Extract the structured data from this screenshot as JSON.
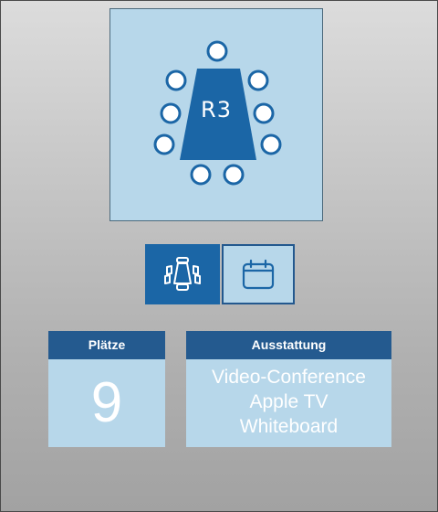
{
  "room": {
    "label": "R3",
    "table_color": "#1b66a6",
    "card_color": "#b7d7ea"
  },
  "tabs": {
    "seating": {
      "icon": "conference-table-icon",
      "selected": true
    },
    "calendar": {
      "icon": "calendar-icon",
      "selected": false
    }
  },
  "seats": {
    "header": "Plätze",
    "value": "9"
  },
  "equipment": {
    "header": "Ausstattung",
    "items": [
      "Video-Conference",
      "Apple TV",
      "Whiteboard"
    ]
  },
  "colors": {
    "accent": "#1b66a6",
    "header_bg": "#245a8f",
    "card_bg": "#b7d7ea"
  }
}
